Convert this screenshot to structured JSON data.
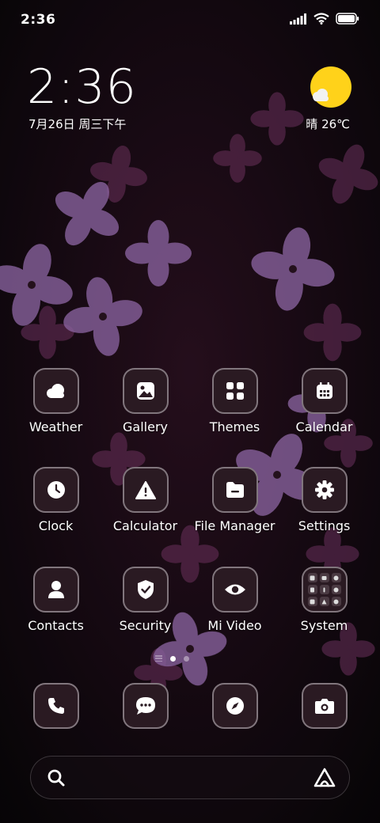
{
  "status_bar": {
    "time": "2:36",
    "icons": [
      "signal-icon",
      "wifi-icon",
      "battery-icon"
    ]
  },
  "clock_widget": {
    "time": "2:36",
    "date": "7月26日 周三下午",
    "weather": "晴 26℃",
    "weather_icon": "sunny-cloud-icon"
  },
  "apps": [
    {
      "label": "Weather",
      "icon": "weather-icon"
    },
    {
      "label": "Gallery",
      "icon": "gallery-icon"
    },
    {
      "label": "Themes",
      "icon": "themes-icon"
    },
    {
      "label": "Calendar",
      "icon": "calendar-icon"
    },
    {
      "label": "Clock",
      "icon": "clock-icon"
    },
    {
      "label": "Calculator",
      "icon": "calculator-icon"
    },
    {
      "label": "File Manager",
      "icon": "file-manager-icon"
    },
    {
      "label": "Settings",
      "icon": "settings-icon"
    },
    {
      "label": "Contacts",
      "icon": "contacts-icon"
    },
    {
      "label": "Security",
      "icon": "security-icon"
    },
    {
      "label": "Mi Video",
      "icon": "mi-video-icon"
    },
    {
      "label": "System",
      "icon": "system-folder-icon"
    }
  ],
  "page_indicator": {
    "pages": 2,
    "active": 0
  },
  "dock": [
    {
      "icon": "phone-icon"
    },
    {
      "icon": "messages-icon"
    },
    {
      "icon": "browser-icon"
    },
    {
      "icon": "camera-icon"
    }
  ],
  "search_bar": {
    "icon": "search-icon",
    "assistant_icon": "assistant-icon"
  },
  "colors": {
    "icon_tile": "#2a1a22",
    "sun": "#ffd21a"
  }
}
